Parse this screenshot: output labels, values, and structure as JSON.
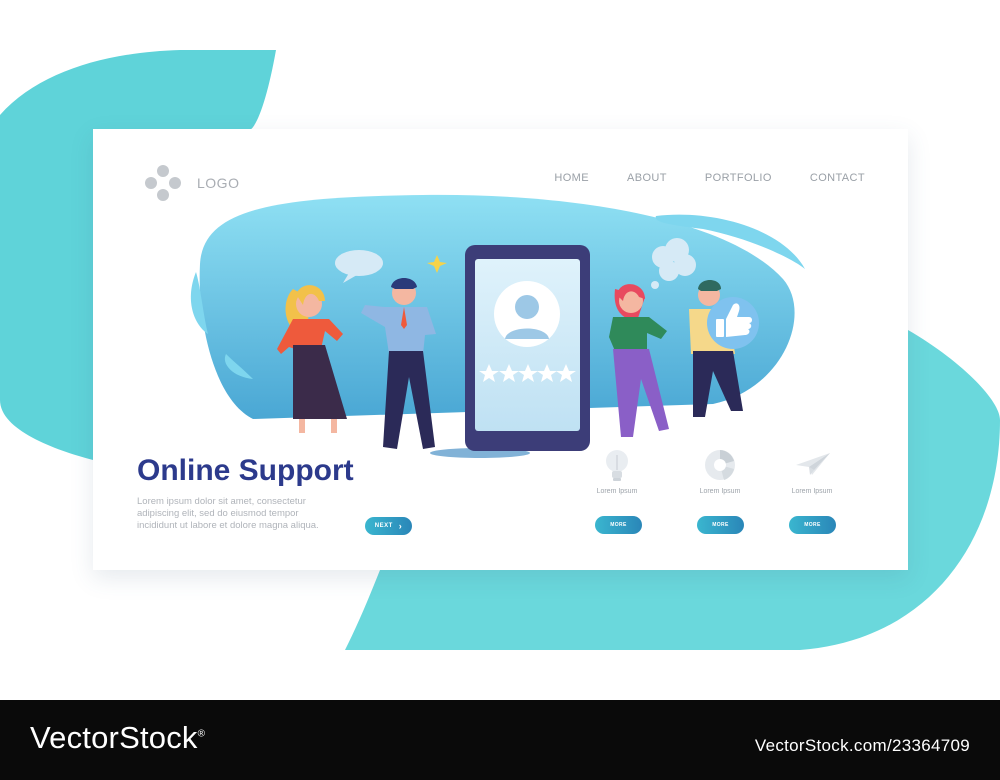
{
  "colors": {
    "teal": "#5ad4d8",
    "hero_blue": "#6cc3e2",
    "title": "#2c3a8c",
    "button": "#2f9cc4",
    "footer": "#0a0a0a"
  },
  "header": {
    "logo_text": "LOGO",
    "nav": [
      "HOME",
      "ABOUT",
      "PORTFOLIO",
      "CONTACT"
    ]
  },
  "hero": {
    "title": "Online Support",
    "description": "Lorem ipsum dolor sit amet, consectetur adipiscing elit, sed do eiusmod tempor incididunt ut labore et dolore magna aliqua.",
    "next_label": "NEXT",
    "rating_stars": 5
  },
  "features": [
    {
      "icon": "lightbulb-icon",
      "caption": "Lorem Ipsum",
      "button": "MORE"
    },
    {
      "icon": "pie-chart-icon",
      "caption": "Lorem Ipsum",
      "button": "MORE"
    },
    {
      "icon": "paper-plane-icon",
      "caption": "Lorem Ipsum",
      "button": "MORE"
    }
  ],
  "footer": {
    "brand": "VectorStock",
    "brand_mark": "®",
    "image_id": "VectorStock.com/23364709"
  }
}
